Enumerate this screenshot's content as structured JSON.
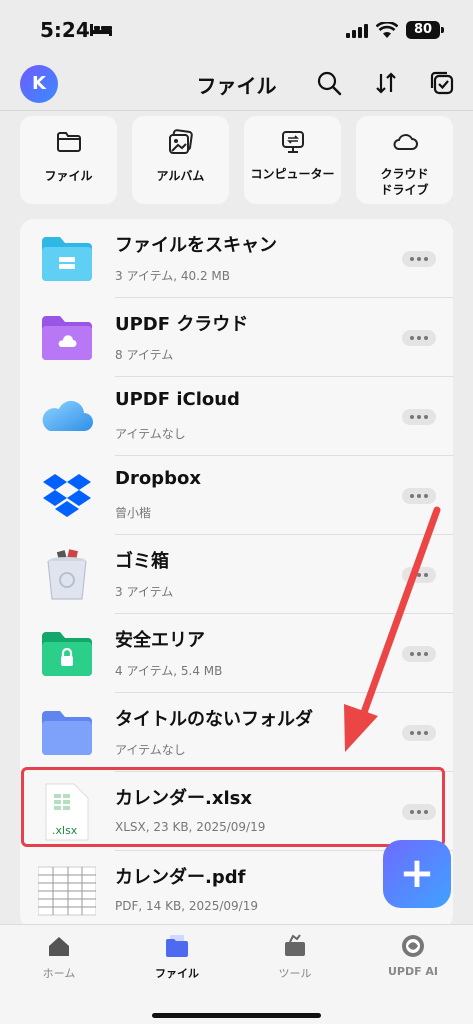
{
  "status": {
    "time": "5:24",
    "battery": "80"
  },
  "header": {
    "avatar_letter": "K",
    "title": "ファイル"
  },
  "quick": [
    {
      "label": "ファイル",
      "icon": "folder-outline-icon"
    },
    {
      "label": "アルバム",
      "icon": "album-icon"
    },
    {
      "label": "コンピューター",
      "icon": "computer-icon"
    },
    {
      "label": "クラウドドライブ",
      "icon": "cloud-icon"
    }
  ],
  "list": [
    {
      "name": "ファイルをスキャン",
      "sub": "3 アイテム, 40.2 MB",
      "icon": "scan-folder-icon"
    },
    {
      "name": "UPDF クラウド",
      "sub": "8 アイテム",
      "icon": "updf-cloud-folder-icon"
    },
    {
      "name": "UPDF iCloud",
      "sub": "アイテムなし",
      "icon": "icloud-icon"
    },
    {
      "name": "Dropbox",
      "sub": "曾小楷",
      "icon": "dropbox-icon"
    },
    {
      "name": "ゴミ箱",
      "sub": "3 アイテム",
      "icon": "trash-icon"
    },
    {
      "name": "安全エリア",
      "sub": "4 アイテム, 5.4 MB",
      "icon": "secure-folder-icon"
    },
    {
      "name": "タイトルのないフォルダ",
      "sub": "アイテムなし",
      "icon": "folder-icon"
    },
    {
      "name": "カレンダー.xlsx",
      "sub": "XLSX, 23 KB, 2025/09/19",
      "icon": "xlsx-file-icon",
      "ext_label": ".xlsx"
    },
    {
      "name": "カレンダー.pdf",
      "sub": "PDF, 14 KB, 2025/09/19",
      "icon": "pdf-thumbnail-icon"
    }
  ],
  "fab": {
    "label": "+"
  },
  "tabs": [
    {
      "label": "ホーム",
      "icon": "home-icon"
    },
    {
      "label": "ファイル",
      "icon": "files-icon"
    },
    {
      "label": "ツール",
      "icon": "tools-icon"
    },
    {
      "label": "UPDF AI",
      "icon": "ai-icon"
    }
  ],
  "colors": {
    "accent": "#5b6cff",
    "highlight": "#e5404b"
  }
}
